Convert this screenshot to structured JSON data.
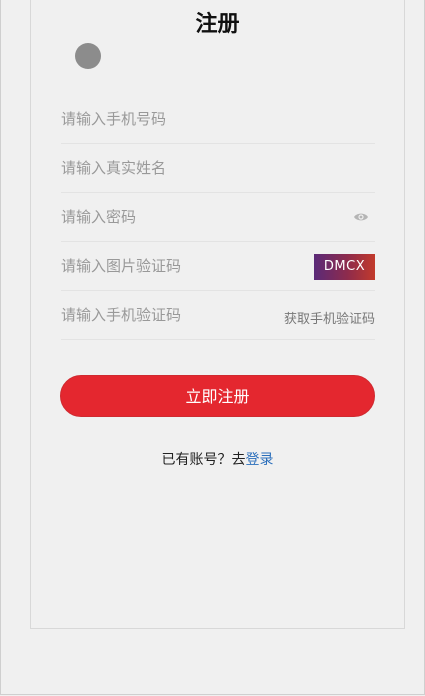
{
  "page": {
    "title": "注册"
  },
  "form": {
    "phone_placeholder": "请输入手机号码",
    "name_placeholder": "请输入真实姓名",
    "password_placeholder": "请输入密码",
    "captcha_placeholder": "请输入图片验证码",
    "captcha_text": "DMCX",
    "sms_placeholder": "请输入手机验证码",
    "sms_button_label": "获取手机验证码"
  },
  "actions": {
    "register_label": "立即注册",
    "login_prompt": "已有账号？去",
    "login_link": "登录"
  },
  "colors": {
    "primary": "#e4272f",
    "link": "#2a6ebb",
    "background": "#f0f0f0"
  },
  "icons": {
    "back": "back-dot-icon",
    "password_toggle": "eye-icon"
  }
}
